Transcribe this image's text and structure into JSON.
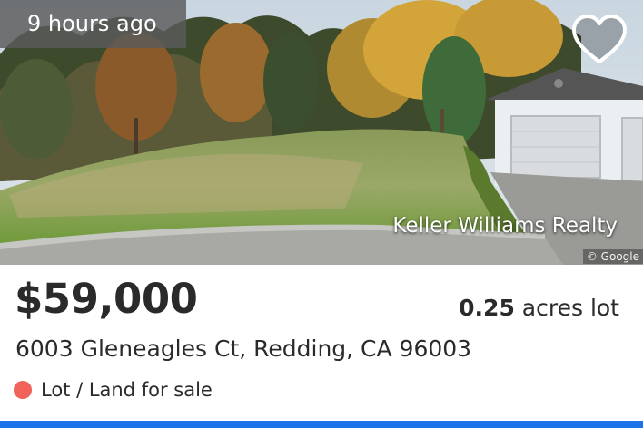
{
  "listing": {
    "time_ago": "9 hours ago",
    "price": "$59,000",
    "lot_size_value": "0.25",
    "lot_size_unit": "acres lot",
    "address": "6003 Gleneagles Ct, Redding, CA 96003",
    "status_text": "Lot / Land for sale",
    "status_color": "#f0625a",
    "broker": "Keller Williams Realty",
    "photo_credit": "© Google"
  },
  "icons": {
    "favorite": "heart-outline-icon",
    "status": "status-dot-icon"
  },
  "colors": {
    "accent": "#1a73e8",
    "text": "#2a2a2a",
    "badge_bg": "#5a5a5a"
  }
}
